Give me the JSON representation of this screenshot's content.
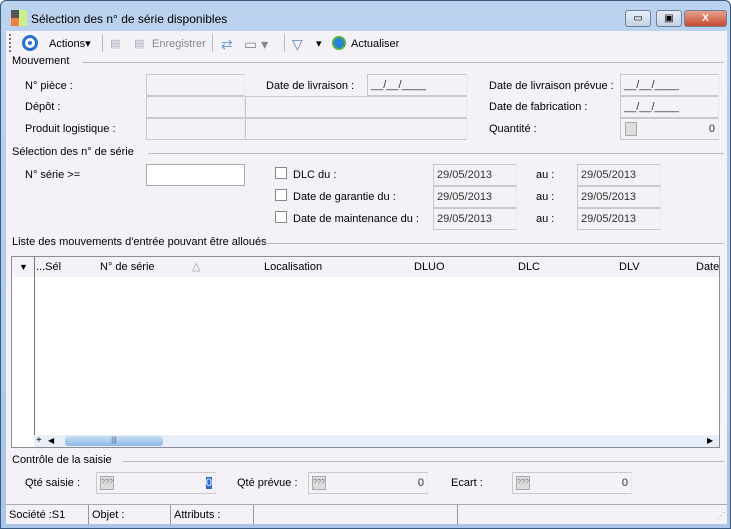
{
  "window": {
    "title": "Sélection des n° de série disponibles",
    "minimize": "▭",
    "maximize": "▣",
    "close": "X"
  },
  "toolbar": {
    "actions": "Actions",
    "save": "Enregistrer",
    "refresh": "Actualiser"
  },
  "mouvement": {
    "title": "Mouvement",
    "piece": "N° pièce :",
    "date_livraison": "Date de livraison :",
    "date_livraison_value": "__/__/____",
    "date_livraison_prevue": "Date de livraison prévue :",
    "date_livraison_prevue_value": "__/__/____",
    "depot": "Dépôt :",
    "date_fabrication": "Date de fabrication :",
    "date_fabrication_value": "__/__/____",
    "produit": "Produit logistique :",
    "quantite": "Quantité :",
    "quantite_value": "0"
  },
  "selection": {
    "title": "Sélection des n° de série",
    "serie": "N° série >=",
    "serie_value": "",
    "rows": [
      {
        "label": "DLC du :",
        "from": "29/05/2013",
        "au": "au :",
        "to": "29/05/2013"
      },
      {
        "label": "Date de garantie du :",
        "from": "29/05/2013",
        "au": "au :",
        "to": "29/05/2013"
      },
      {
        "label": "Date de maintenance du :",
        "from": "29/05/2013",
        "au": "au :",
        "to": "29/05/2013"
      }
    ]
  },
  "liste": {
    "title": "Liste des mouvements d'entrée pouvant être alloués",
    "columns": [
      "...Sél",
      "N° de série",
      "Localisation",
      "DLUO",
      "DLC",
      "DLV",
      "Date"
    ]
  },
  "controle": {
    "title": "Contrôle de la saisie",
    "qte_saisie": "Qté saisie :",
    "qte_saisie_value": "0",
    "qte_prevue": "Qté prévue :",
    "qte_prevue_value": "0",
    "ecart": "Ecart :",
    "ecart_value": "0",
    "calc": "???"
  },
  "status": {
    "societe": "Société :S1",
    "objet": "Objet :",
    "attributs": "Attributs :"
  }
}
